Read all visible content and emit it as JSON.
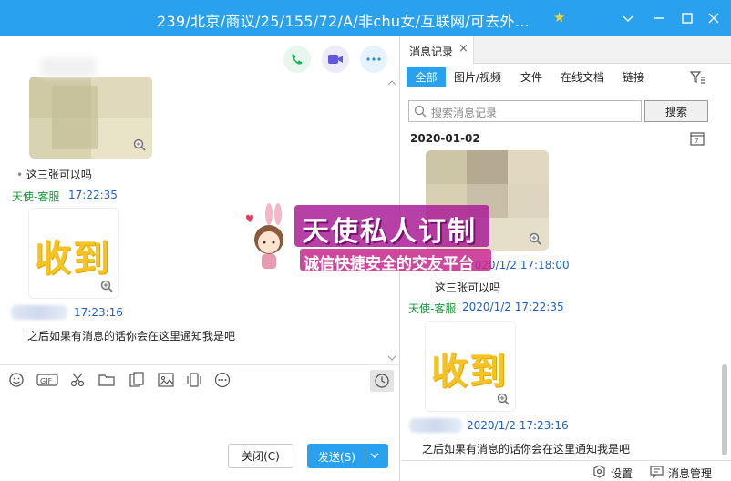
{
  "window": {
    "title": "239/北京/商议/25/155/72/A/非chu女/互联网/可去外...",
    "star_icon": "star-icon"
  },
  "chat": {
    "messages": [
      {
        "type": "image",
        "caption": ""
      },
      {
        "type": "text",
        "text": "这三张可以吗"
      },
      {
        "sender": "天使-客服",
        "time": "17:22:35",
        "type": "sticker",
        "sticker_text": "收到"
      },
      {
        "sender": "",
        "time": "17:23:16",
        "type": "text",
        "text": "之后如果有消息的话你会在这里通知我是吧"
      }
    ]
  },
  "watermark": {
    "title": "天使私人订制",
    "subtitle": "诚信快捷安全的交友平台"
  },
  "buttons": {
    "close_label": "关闭(C)",
    "send_label": "发送(S)"
  },
  "history": {
    "tab_label": "消息记录",
    "filters": [
      "全部",
      "图片/视频",
      "文件",
      "在线文档",
      "链接"
    ],
    "search_placeholder": "搜索消息记录",
    "search_button": "搜索",
    "date": "2020-01-02",
    "entries": [
      {
        "sender": "",
        "time": "2020/1/2 17:18:00",
        "text": "这三张可以吗"
      },
      {
        "sender": "天使-客服",
        "time": "2020/1/2 17:22:35",
        "sticker_text": "收到"
      },
      {
        "sender": "",
        "time": "2020/1/2 17:23:16",
        "text": "之后如果有消息的话你会在这里通知我是吧"
      }
    ],
    "settings_label": "设置",
    "manage_label": "消息管理"
  },
  "colors": {
    "accent": "#2aa1ee",
    "sender_green": "#1a9a3a",
    "time_blue": "#1e5fd0",
    "sticker_yellow": "#f6c324"
  }
}
